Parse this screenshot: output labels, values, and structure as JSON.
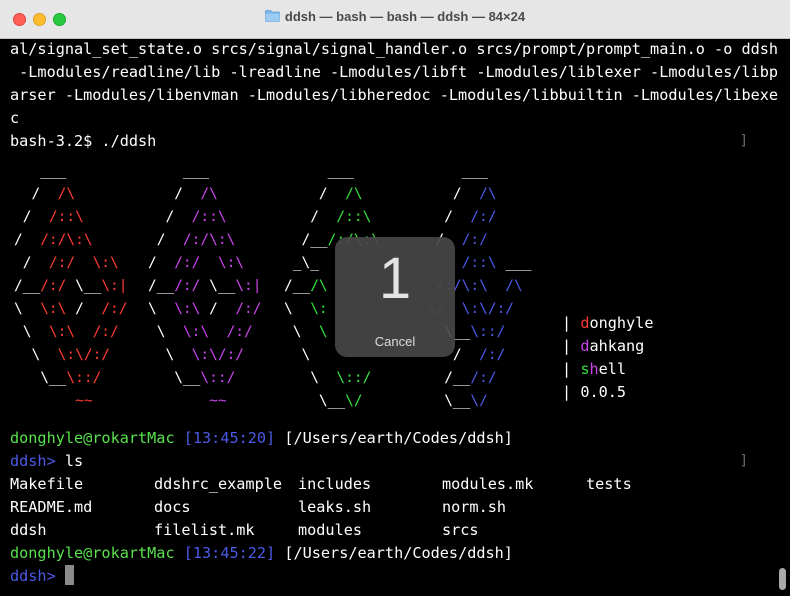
{
  "window": {
    "title": "ddsh — bash — bash — ddsh — 84×24",
    "folder_icon": "folder-icon"
  },
  "terminal": {
    "lines": [
      "al/signal_set_state.o srcs/signal/signal_handler.o srcs/prompt/prompt_main.o -o ddsh",
      " -Lmodules/readline/lib -lreadline -Lmodules/libft -Lmodules/liblexer -Lmodules/libp",
      "arser -Lmodules/libenvman -Lmodules/libheredoc -Lmodules/libbuiltin -Lmodules/libexe",
      "c",
      "bash-3.2$ ./ddsh"
    ],
    "prompt1": {
      "user": "donghyle@rokartMac",
      "time": "[13:45:20]",
      "path": "[/Users/earth/Codes/ddsh]"
    },
    "ddsh_prompt": "ddsh>",
    "command": "ls",
    "ls_rows": [
      [
        "Makefile",
        "ddshrc_example",
        "includes",
        "modules.mk",
        "tests"
      ],
      [
        "README.md",
        "docs",
        "leaks.sh",
        "norm.sh",
        ""
      ],
      [
        "ddsh",
        "filelist.mk",
        "modules",
        "srcs",
        ""
      ]
    ],
    "prompt2": {
      "user": "donghyle@rokartMac",
      "time": "[13:45:22]",
      "path": "[/Users/earth/Codes/ddsh]"
    },
    "ddsh_prompt2": "ddsh>"
  },
  "banner": {
    "info": {
      "bar": "|",
      "author1_first": "d",
      "author1_rest": "onghyle",
      "author2_first": "d",
      "author2_rest": "ahkang",
      "shell_s": "s",
      "shell_h": "h",
      "shell_rest": "ell",
      "version": "0.0.5"
    }
  },
  "overlay": {
    "count": "1",
    "cancel_label": "Cancel"
  },
  "colors": {
    "red": "#ff3b30",
    "magenta": "#cc44ee",
    "green": "#39e23f",
    "blue": "#4c5ae6",
    "prompt_green": "#58e24c"
  }
}
